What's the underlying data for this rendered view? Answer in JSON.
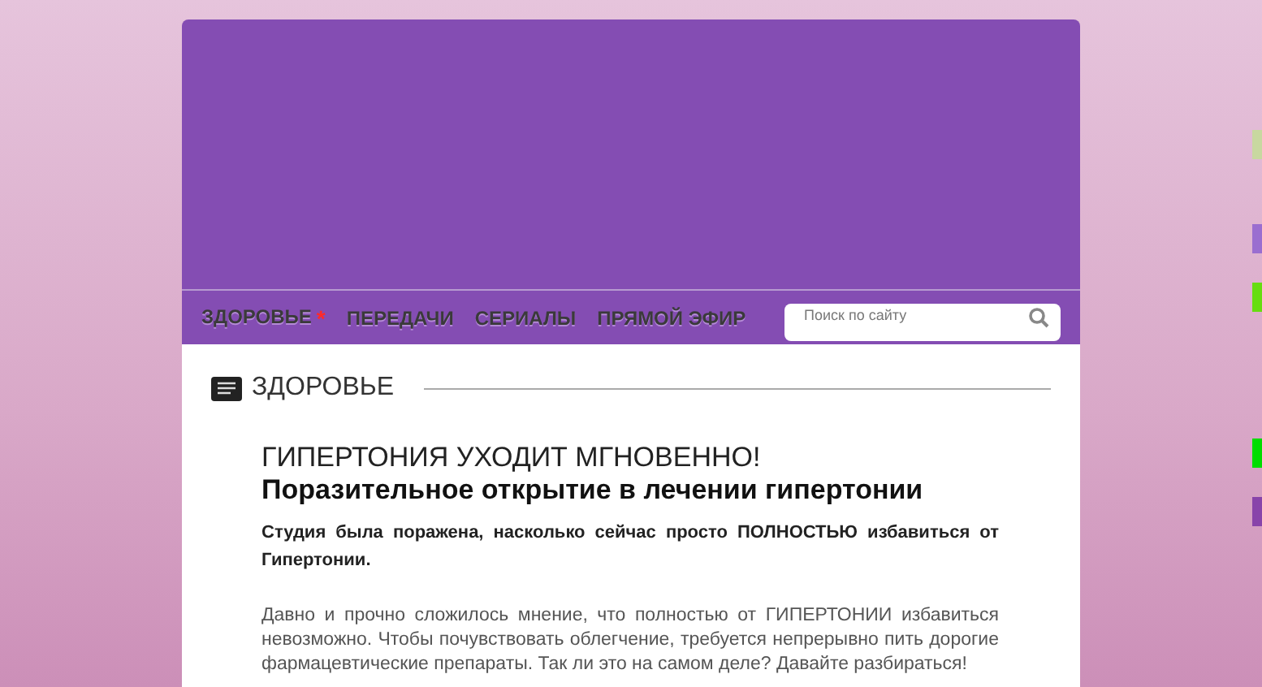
{
  "nav": {
    "items": [
      {
        "label": "ЗДОРОВЬЕ",
        "badge": "*"
      },
      {
        "label": "ПЕРЕДАЧИ"
      },
      {
        "label": "СЕРИАЛЫ"
      },
      {
        "label": "ПРЯМОЙ ЭФИР"
      }
    ]
  },
  "search": {
    "placeholder": "Поиск по сайту"
  },
  "section": {
    "title": "ЗДОРОВЬЕ"
  },
  "article": {
    "headline": "ГИПЕРТОНИЯ УХОДИТ МГНОВЕННО!",
    "subheadline": "Поразительное открытие в лечении гипертонии",
    "lede": "Студия была поражена, насколько сейчас просто ПОЛНОСТЬЮ избавиться от Гипертонии.",
    "body": "Давно и прочно сложилось мнение, что полностью от ГИПЕРТОНИИ избавиться невозможно. Чтобы почувствовать облегчение, требуется непрерывно пить дорогие фармацевтические препараты. Так ли это на самом деле? Давайте разбираться!"
  },
  "side_tabs": [
    {
      "color": "#c8d8a0"
    },
    {
      "color": "#9a6ed0"
    },
    {
      "color": "#66dd11"
    },
    {
      "color": "#00dd00"
    },
    {
      "color": "#8844aa"
    }
  ]
}
